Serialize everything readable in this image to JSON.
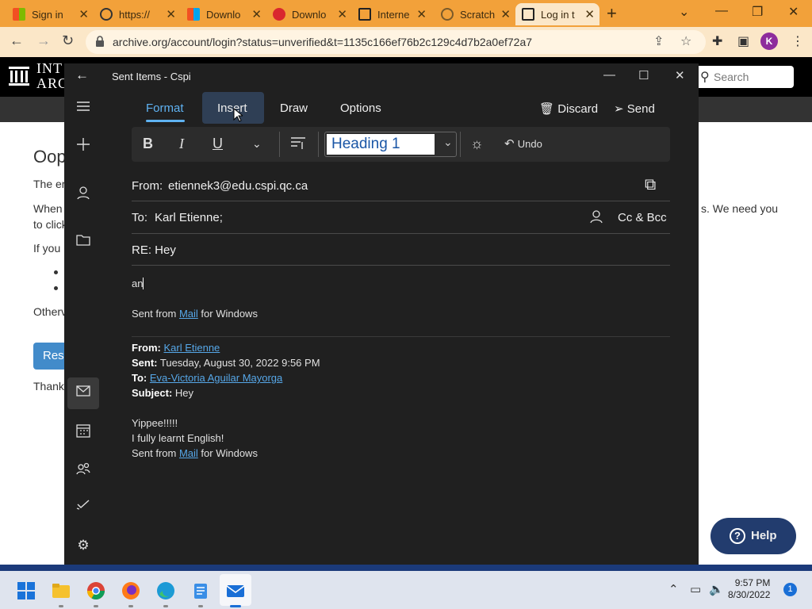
{
  "browser": {
    "tabs": [
      {
        "title": "Sign in"
      },
      {
        "title": "https://"
      },
      {
        "title": "Downlo"
      },
      {
        "title": "Downlo"
      },
      {
        "title": "Interne"
      },
      {
        "title": "Scratch"
      },
      {
        "title": "Log in t"
      }
    ],
    "url": "archive.org/account/login?status=unverified&t=1135c166ef76b2c129c4d7b2a0ef72a7",
    "profile_initial": "K"
  },
  "background_page": {
    "logo_line1": "INT",
    "logo_line2": "ARC",
    "search_placeholder": "Search",
    "heading": "Oop",
    "lines": [
      "The er",
      "When",
      "to click",
      "If you",
      "Otherv",
      "Thank"
    ],
    "right_text": "s. We need you",
    "button_label": "Res",
    "help_label": "Help"
  },
  "mail": {
    "window_title": "Sent Items - Cspi",
    "tabs": [
      "Format",
      "Insert",
      "Draw",
      "Options"
    ],
    "discard_label": "Discard",
    "send_label": "Send",
    "undo_label": "Undo",
    "style_value": "Heading 1",
    "from_label": "From:",
    "from_value": "etiennek3@edu.cspi.qc.ca",
    "to_label": "To:",
    "to_value": "Karl Etienne;",
    "cc_label": "Cc & Bcc",
    "subject": "RE: Hey",
    "draft_text": "an",
    "signature": {
      "prefix": "Sent from ",
      "link": "Mail",
      "suffix": " for Windows"
    },
    "quoted": {
      "from_label": "From:",
      "from_value": "Karl Etienne",
      "sent_label": "Sent:",
      "sent_value": "Tuesday, August 30, 2022 9:56 PM",
      "to_label": "To:",
      "to_value": "Eva-Victoria Aguilar Mayorga",
      "subject_label": "Subject:",
      "subject_value": "Hey",
      "body_line1": "Yippee!!!!!",
      "body_line2": "I fully learnt English!",
      "sig_prefix": "Sent from ",
      "sig_link": "Mail",
      "sig_suffix": " for Windows"
    }
  },
  "taskbar": {
    "time": "9:57 PM",
    "date": "8/30/2022",
    "notification_count": "1"
  }
}
